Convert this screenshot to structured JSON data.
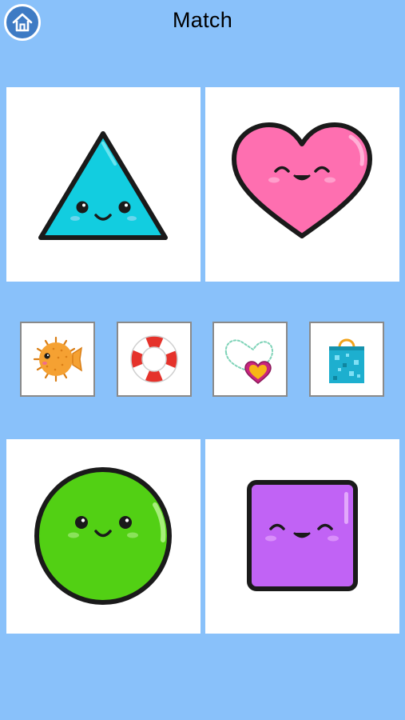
{
  "header": {
    "title": "Match",
    "home_icon": "home-icon"
  },
  "shape_cards": [
    {
      "shape": "triangle",
      "color": "#12CDE0",
      "face": "smiling"
    },
    {
      "shape": "heart",
      "color": "#FE6FB0",
      "face": "happy-closed-eyes"
    },
    {
      "shape": "circle",
      "color": "#52D014",
      "face": "smiling"
    },
    {
      "shape": "square",
      "color": "#C163F5",
      "face": "happy-closed-eyes"
    }
  ],
  "options": [
    {
      "item": "pufferfish",
      "color": "#F5A132"
    },
    {
      "item": "lifebuoy",
      "color": "#E5322B"
    },
    {
      "item": "heart-necklace",
      "color": "#F7B516"
    },
    {
      "item": "shopping-bag",
      "color": "#1DAFCF"
    }
  ],
  "colors": {
    "background": "#89C1FA",
    "card": "#FFFFFF",
    "option_border": "#8A8A8A",
    "home_button": "#3E7BC4"
  }
}
